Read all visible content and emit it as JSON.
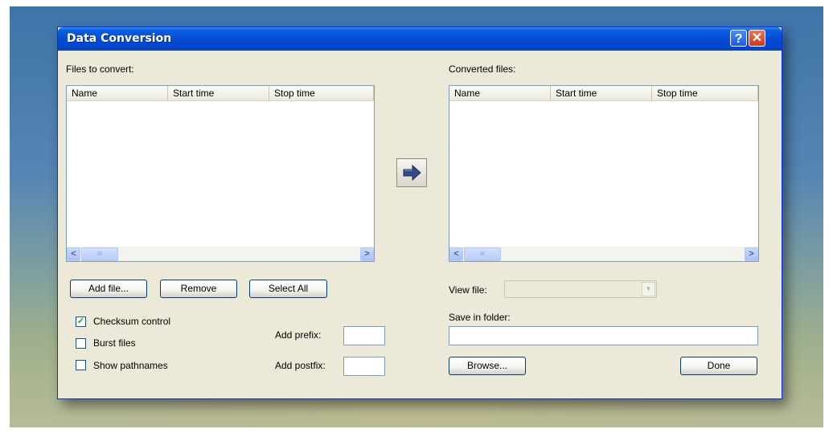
{
  "window": {
    "title": "Data Conversion",
    "help_glyph": "?",
    "close_glyph": "✕"
  },
  "left": {
    "label": "Files to convert:",
    "columns": [
      "Name",
      "Start time",
      "Stop time"
    ],
    "rows": []
  },
  "right": {
    "label": "Converted files:",
    "columns": [
      "Name",
      "Start time",
      "Stop time"
    ],
    "rows": []
  },
  "scroll": {
    "left_glyph": "<",
    "right_glyph": ">",
    "thumb_glyph": "III"
  },
  "buttons": {
    "add_file": "Add file...",
    "remove": "Remove",
    "select_all": "Select All",
    "browse": "Browse...",
    "done": "Done"
  },
  "options": {
    "checksum": {
      "label": "Checksum control",
      "checked": true
    },
    "burst": {
      "label": "Burst files",
      "checked": false
    },
    "pathnames": {
      "label": "Show pathnames",
      "checked": false
    },
    "prefix_label": "Add prefix:",
    "prefix_value": "",
    "postfix_label": "Add postfix:",
    "postfix_value": ""
  },
  "view_file": {
    "label": "View file:",
    "value": "",
    "enabled": false
  },
  "save_folder": {
    "label": "Save in folder:",
    "value": ""
  },
  "icons": {
    "convert": "right-arrow-icon"
  },
  "colors": {
    "title_bar": "#0548d2",
    "dialog_bg": "#ece9d8",
    "close": "#c83a1c"
  }
}
